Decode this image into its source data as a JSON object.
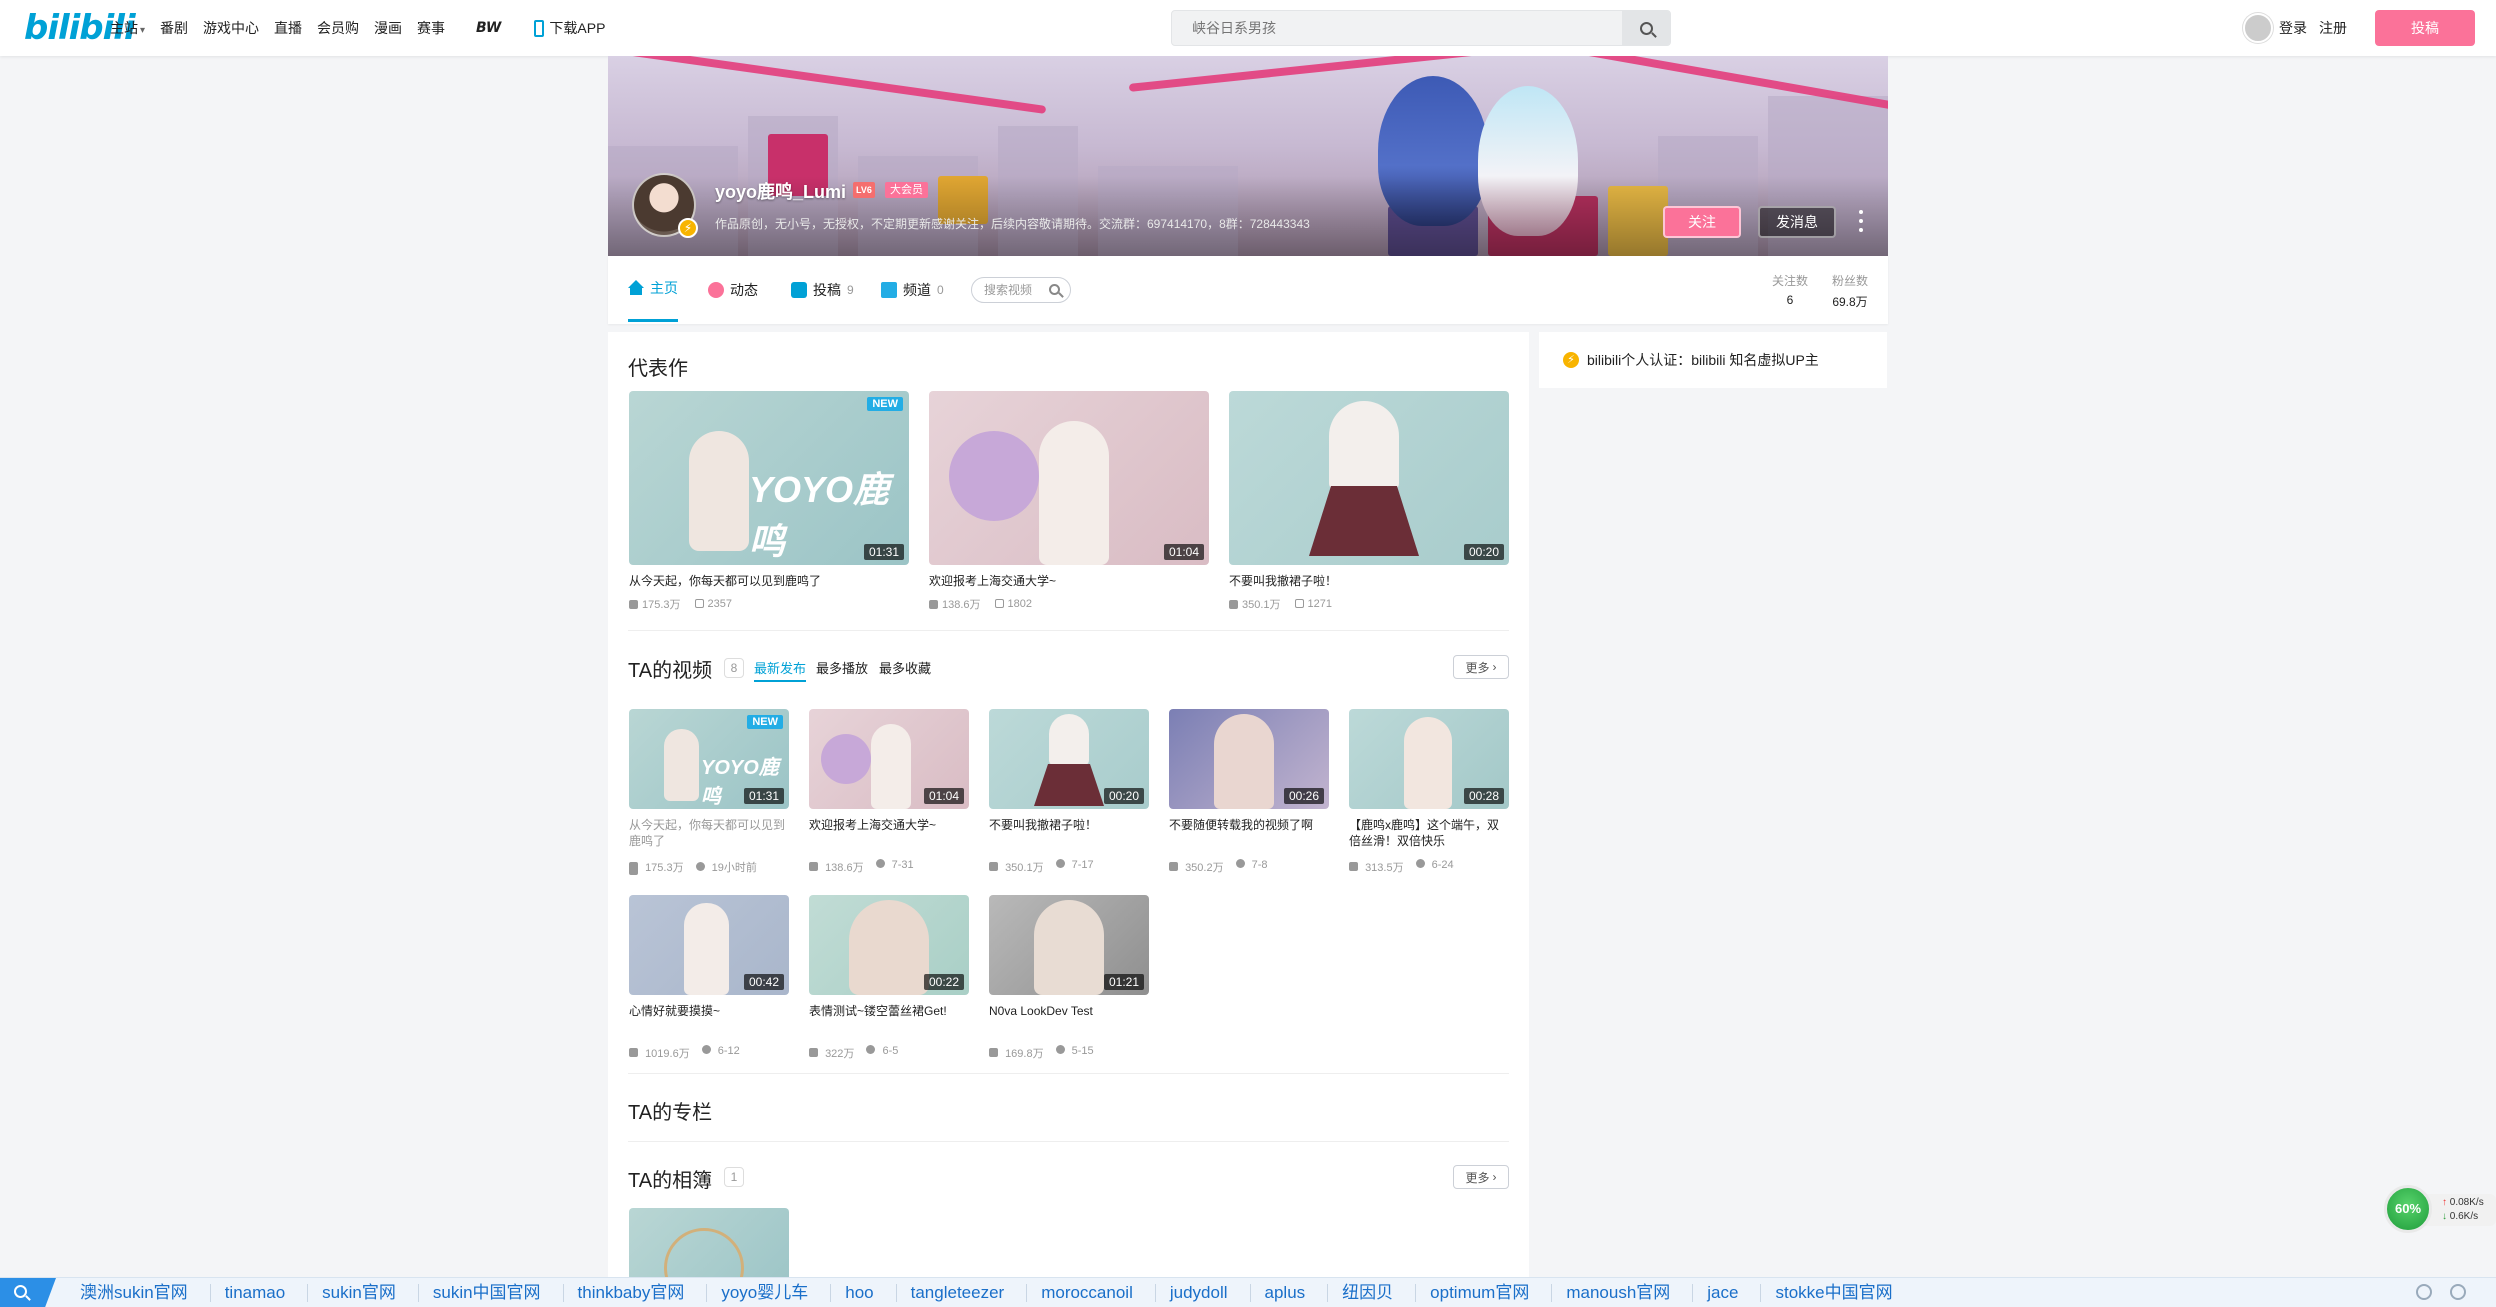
{
  "nav": {
    "logo": "bilibili",
    "links": [
      "主站",
      "番剧",
      "游戏中心",
      "直播",
      "会员购",
      "漫画",
      "赛事"
    ],
    "bw": "BW",
    "download": "下载APP",
    "search_placeholder": "峡谷日系男孩",
    "login": "登录",
    "register": "注册",
    "upload": "投稿"
  },
  "profile": {
    "name": "yoyo鹿鸣_Lumi",
    "level_badge": "LV6",
    "vip_badge": "大会员",
    "sign": "作品原创，无小号，无授权，不定期更新感谢关注，后续内容敬请期待。交流群：697414170，8群：728443343",
    "follow": "关注",
    "message": "发消息"
  },
  "tabs": {
    "home": "主页",
    "dynamic": "动态",
    "posts": "投稿",
    "posts_count": "9",
    "channels": "频道",
    "channels_count": "0",
    "search_placeholder": "搜索视频",
    "following_label": "关注数",
    "following_value": "6",
    "fans_label": "粉丝数",
    "fans_value": "69.8万"
  },
  "representative": {
    "title": "代表作",
    "items": [
      {
        "title": "从今天起，你每天都可以见到鹿鸣了",
        "duration": "01:31",
        "views": "175.3万",
        "danmaku": "2357",
        "new": "NEW"
      },
      {
        "title": "欢迎报考上海交通大学~",
        "duration": "01:04",
        "views": "138.6万",
        "danmaku": "1802"
      },
      {
        "title": "不要叫我撤裙子啦！",
        "duration": "00:20",
        "views": "350.1万",
        "danmaku": "1271"
      }
    ]
  },
  "videos": {
    "title": "TA的视频",
    "count": "8",
    "sort_latest": "最新发布",
    "sort_play": "最多播放",
    "sort_fav": "最多收藏",
    "more": "更多",
    "items": [
      {
        "title": "从今天起，你每天都可以见到鹿鸣了",
        "duration": "01:31",
        "views": "175.3万",
        "date": "19小时前",
        "new": "NEW"
      },
      {
        "title": "欢迎报考上海交通大学~",
        "duration": "01:04",
        "views": "138.6万",
        "date": "7-31"
      },
      {
        "title": "不要叫我撤裙子啦！",
        "duration": "00:20",
        "views": "350.1万",
        "date": "7-17"
      },
      {
        "title": "不要随便转载我的视频了啊",
        "duration": "00:26",
        "views": "350.2万",
        "date": "7-8"
      },
      {
        "title": "【鹿鸣x鹿鸣】这个端午，双倍丝滑！双倍快乐",
        "duration": "00:28",
        "views": "313.5万",
        "date": "6-24"
      },
      {
        "title": "心情好就要摸摸~",
        "duration": "00:42",
        "views": "1019.6万",
        "date": "6-12"
      },
      {
        "title": "表情测试~镂空蕾丝裙Get!",
        "duration": "00:22",
        "views": "322万",
        "date": "6-5"
      },
      {
        "title": "N0va LookDev Test",
        "duration": "01:21",
        "views": "169.8万",
        "date": "5-15"
      }
    ]
  },
  "column": {
    "title": "TA的专栏"
  },
  "album": {
    "title": "TA的相簿",
    "count": "1",
    "more": "更多"
  },
  "sidebar": {
    "cert": "bilibili个人认证：bilibili 知名虚拟UP主"
  },
  "speed_widget": {
    "percent": "60%",
    "up": "0.08K/s",
    "down": "0.6K/s"
  },
  "bottom_links": [
    "澳洲sukin官网",
    "tinamao",
    "sukin官网",
    "sukin中国官网",
    "thinkbaby官网",
    "yoyo婴儿车",
    "hoo",
    "tangleteezer",
    "moroccanoil",
    "judydoll",
    "aplus",
    "纽因贝",
    "optimum官网",
    "manoush官网",
    "jace",
    "stokke中国官网"
  ],
  "colors": {
    "brand_blue": "#00a1d6",
    "brand_pink": "#fb7299",
    "vip_red": "#f56e6e"
  }
}
